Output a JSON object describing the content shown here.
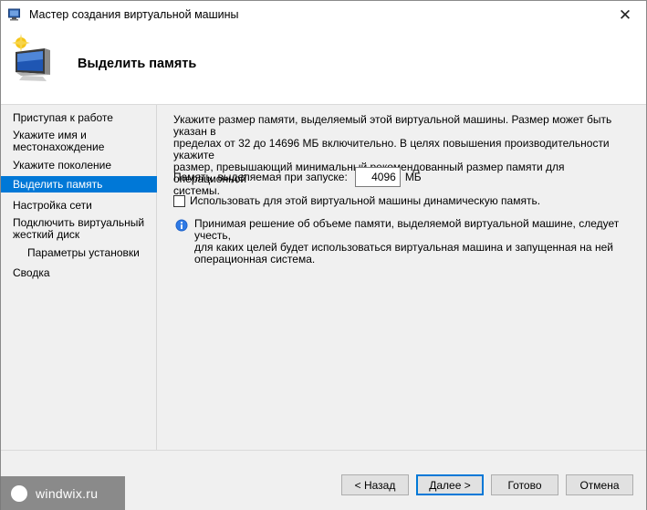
{
  "window": {
    "title": "Мастер создания виртуальной машины",
    "close_symbol": "✕"
  },
  "header": {
    "title": "Выделить память",
    "icon": "vm-wizard-icon"
  },
  "sidebar": {
    "items": [
      {
        "label": "Приступая к работе",
        "state": "normal"
      },
      {
        "label": "Укажите имя и",
        "label2": "местонахождение",
        "state": "normal"
      },
      {
        "label": "Укажите поколение",
        "state": "normal"
      },
      {
        "label": "Выделить память",
        "state": "active"
      },
      {
        "label": "Настройка сети",
        "state": "normal"
      },
      {
        "label": "Подключить виртуальный",
        "label2": "жесткий диск",
        "state": "normal"
      },
      {
        "label": "Параметры установки",
        "state": "sub"
      },
      {
        "label": "Сводка",
        "state": "normal"
      }
    ],
    "active_color": "#0078d7"
  },
  "content": {
    "description_lines": [
      "Укажите размер памяти, выделяемый этой виртуальной машины. Размер может быть указан в",
      "пределах от 32 до 14696 МБ включительно. В целях повышения производительности укажите",
      "размер, превышающий минимальный рекомендованный размер памяти для операционной",
      "системы."
    ],
    "memory_label": "Память, выделяемая при запуске:",
    "memory_value": "4096",
    "memory_unit": "МБ",
    "dynamic_memory_label": "Использовать для этой виртуальной машины динамическую память.",
    "dynamic_memory_checked": false,
    "info_lines": [
      "Принимая решение об объеме памяти, выделяемой виртуальной машине, следует учесть,",
      "для каких целей будет использоваться виртуальная машина и запущенная на ней",
      "операционная система."
    ],
    "info_icon": "info-icon"
  },
  "footer": {
    "back_label": "< Назад",
    "next_label": "Далее >",
    "finish_label": "Готово",
    "cancel_label": "Отмена"
  },
  "watermark": {
    "text": "windwix.ru"
  }
}
